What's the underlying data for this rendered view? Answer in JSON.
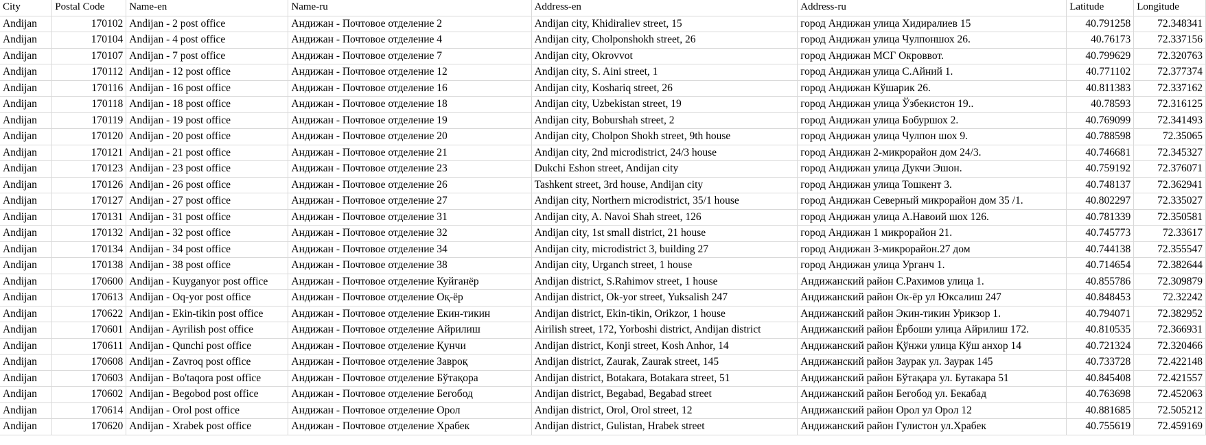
{
  "table": {
    "columns": [
      {
        "key": "city",
        "label": "City"
      },
      {
        "key": "postal",
        "label": "Postal Code"
      },
      {
        "key": "name_en",
        "label": "Name-en"
      },
      {
        "key": "name_ru",
        "label": "Name-ru"
      },
      {
        "key": "address_en",
        "label": "Address-en"
      },
      {
        "key": "address_ru",
        "label": "Address-ru"
      },
      {
        "key": "latitude",
        "label": "Latitude"
      },
      {
        "key": "longitude",
        "label": "Longitude"
      }
    ],
    "rows": [
      {
        "city": "Andijan",
        "postal": "170102",
        "name_en": "Andijan - 2 post office",
        "name_ru": "Андижан - Почтовое отделение 2",
        "address_en": "Andijan city, Khidiraliev street, 15",
        "address_ru": "город Андижан улица  Хидиралиев  15",
        "latitude": "40.791258",
        "longitude": "72.348341"
      },
      {
        "city": "Andijan",
        "postal": "170104",
        "name_en": "Andijan - 4 post office",
        "name_ru": "Андижан - Почтовое отделение 4",
        "address_en": "Andijan city, Cholponshokh street, 26",
        "address_ru": "город Андижан улица   Чулпоншох 26.",
        "latitude": "40.76173",
        "longitude": "72.337156"
      },
      {
        "city": "Andijan",
        "postal": "170107",
        "name_en": "Andijan - 7 post office",
        "name_ru": "Андижан - Почтовое отделение 7",
        "address_en": "Andijan city, Okrovvot",
        "address_ru": "город Андижан    МСГ Окроввот.",
        "latitude": "40.799629",
        "longitude": "72.320763"
      },
      {
        "city": "Andijan",
        "postal": "170112",
        "name_en": "Andijan - 12 post office",
        "name_ru": "Андижан - Почтовое отделение 12",
        "address_en": "Andijan city, S. Aini street, 1",
        "address_ru": "город Андижан улица   С.Айний 1.",
        "latitude": "40.771102",
        "longitude": "72.377374"
      },
      {
        "city": "Andijan",
        "postal": "170116",
        "name_en": "Andijan - 16 post office",
        "name_ru": "Андижан - Почтовое отделение 16",
        "address_en": "Andijan city, Koshariq street, 26",
        "address_ru": "город Андижан    Кўшарик  26.",
        "latitude": "40.811383",
        "longitude": "72.337162"
      },
      {
        "city": "Andijan",
        "postal": "170118",
        "name_en": "Andijan - 18 post office",
        "name_ru": "Андижан - Почтовое отделение 18",
        "address_en": "Andijan city, Uzbekistan street, 19",
        "address_ru": "город Андижан улица   Ўзбекистон 19..",
        "latitude": "40.78593",
        "longitude": "72.316125"
      },
      {
        "city": "Andijan",
        "postal": "170119",
        "name_en": "Andijan - 19 post office",
        "name_ru": "Андижан - Почтовое отделение 19",
        "address_en": "Andijan city, Boburshah street, 2",
        "address_ru": "город Андижан улица   Бобуршох 2.",
        "latitude": "40.769099",
        "longitude": "72.341493"
      },
      {
        "city": "Andijan",
        "postal": "170120",
        "name_en": "Andijan - 20 post office",
        "name_ru": "Андижан - Почтовое отделение 20",
        "address_en": "Andijan city, Cholpon Shokh street, 9th house",
        "address_ru": "город Андижан улица  Чулпон шох 9.",
        "latitude": "40.788598",
        "longitude": "72.35065"
      },
      {
        "city": "Andijan",
        "postal": "170121",
        "name_en": "Andijan - 21 post office",
        "name_ru": "Андижан - Почтовое отделение 21",
        "address_en": "Andijan city, 2nd microdistrict, 24/3 house",
        "address_ru": "город Андижан 2-микрорайон  дом  24/3.",
        "latitude": "40.746681",
        "longitude": "72.345327"
      },
      {
        "city": "Andijan",
        "postal": "170123",
        "name_en": "Andijan - 23 post office",
        "name_ru": "Андижан - Почтовое отделение 23",
        "address_en": "Dukchi Eshon street, Andijan city",
        "address_ru": "город Андижан улица   Дукчи Эшон.",
        "latitude": "40.759192",
        "longitude": "72.376071"
      },
      {
        "city": "Andijan",
        "postal": "170126",
        "name_en": "Andijan - 26 post office",
        "name_ru": "Андижан - Почтовое отделение 26",
        "address_en": "Tashkent street, 3rd house, Andijan city",
        "address_ru": "город Андижан улица    Тошкент  3.",
        "latitude": "40.748137",
        "longitude": "72.362941"
      },
      {
        "city": "Andijan",
        "postal": "170127",
        "name_en": "Andijan - 27 post office",
        "name_ru": "Андижан - Почтовое отделение 27",
        "address_en": "Andijan city, Northern microdistrict, 35/1 house",
        "address_ru": "город Андижан   Северный микрорайон дом 35 /1.",
        "latitude": "40.802297",
        "longitude": "72.335027"
      },
      {
        "city": "Andijan",
        "postal": "170131",
        "name_en": "Andijan - 31 post office",
        "name_ru": "Андижан - Почтовое отделение 31",
        "address_en": "Andijan city, A. Navoi Shah street, 126",
        "address_ru": "город Андижан улица   А.Навоий шох 126.",
        "latitude": "40.781339",
        "longitude": "72.350581"
      },
      {
        "city": "Andijan",
        "postal": "170132",
        "name_en": "Andijan - 32 post office",
        "name_ru": "Андижан - Почтовое отделение 32",
        "address_en": "Andijan city, 1st small district, 21 house",
        "address_ru": "город Андижан 1 микрорайон 21.",
        "latitude": "40.745773",
        "longitude": "72.33617"
      },
      {
        "city": "Andijan",
        "postal": "170134",
        "name_en": "Andijan - 34 post office",
        "name_ru": "Андижан - Почтовое отделение 34",
        "address_en": "Andijan city, microdistrict 3, building 27",
        "address_ru": "город Андижан 3-микрорайон.27 дом",
        "latitude": "40.744138",
        "longitude": "72.355547"
      },
      {
        "city": "Andijan",
        "postal": "170138",
        "name_en": "Andijan - 38 post office",
        "name_ru": "Андижан - Почтовое отделение 38",
        "address_en": "Andijan city, Urganch street, 1 house",
        "address_ru": "город Андижан улица   Урганч 1.",
        "latitude": "40.714654",
        "longitude": "72.382644"
      },
      {
        "city": "Andijan",
        "postal": "170600",
        "name_en": "Andijan - Kuyganyor post office",
        "name_ru": "Андижан - Почтовое отделение Куйганёр",
        "address_en": "Andijan district, S.Rahimov street, 1 house",
        "address_ru": "Андижанский район С.Рахимов улица  1.",
        "latitude": "40.855786",
        "longitude": "72.309879"
      },
      {
        "city": "Andijan",
        "postal": "170613",
        "name_en": "Andijan - Oq-yor post office",
        "name_ru": "Андижан - Почтовое отделение Оқ-ёр",
        "address_en": "Andijan district, Ok-yor street, Yuksalish 247",
        "address_ru": "Андижанский район  Ок-ёр  ул Юксалиш   247",
        "latitude": "40.848453",
        "longitude": "72.32242"
      },
      {
        "city": "Andijan",
        "postal": "170622",
        "name_en": "Andijan - Ekin-tikin post office",
        "name_ru": "Андижан - Почтовое отделение Екин-тикин",
        "address_en": "Andijan district, Ekin-tikin, Orikzor, 1 house",
        "address_ru": "Андижанский район Экин-тикин  Урикзор 1.",
        "latitude": "40.794071",
        "longitude": "72.382952"
      },
      {
        "city": "Andijan",
        "postal": "170601",
        "name_en": "Andijan - Ayrilish post office",
        "name_ru": "Андижан - Почтовое отделение Айрилиш",
        "address_en": "Airilish street, 172, Yorboshi district, Andijan district",
        "address_ru": "Андижанский район Ёрбоши  улица Айрилиш 172.",
        "latitude": "40.810535",
        "longitude": "72.366931"
      },
      {
        "city": "Andijan",
        "postal": "170611",
        "name_en": "Andijan - Qunchi post office",
        "name_ru": "Андижан - Почтовое отделение Қунчи",
        "address_en": "Andijan district, Konji street, Kosh Anhor, 14",
        "address_ru": "Андижанский район  Қўнжи  улица Кўш анхор 14",
        "latitude": "40.721324",
        "longitude": "72.320466"
      },
      {
        "city": "Andijan",
        "postal": "170608",
        "name_en": "Andijan - Zavroq post office",
        "name_ru": "Андижан - Почтовое отделение Завроқ",
        "address_en": "Andijan district, Zaurak, Zaurak street, 145",
        "address_ru": "Андижанский район  Заурак  ул. Заурак  145",
        "latitude": "40.733728",
        "longitude": "72.422148"
      },
      {
        "city": "Andijan",
        "postal": "170603",
        "name_en": "Andijan - Bo'taqora post office",
        "name_ru": "Андижан - Почтовое отделение Бўтақора",
        "address_en": "Andijan district, Botakara, Botakara street, 51",
        "address_ru": "Андижанский район  Бўтақара  ул. Бутакара  51",
        "latitude": "40.845408",
        "longitude": "72.421557"
      },
      {
        "city": "Andijan",
        "postal": "170602",
        "name_en": "Andijan - Begobod post office",
        "name_ru": "Андижан - Почтовое отделение Бегобод",
        "address_en": "Andijan district, Begabad, Begabad street",
        "address_ru": "Андижанский район  Бегобод  ул. Бекабад",
        "latitude": "40.763698",
        "longitude": "72.452063"
      },
      {
        "city": "Andijan",
        "postal": "170614",
        "name_en": "Andijan - Orol post office",
        "name_ru": "Андижан - Почтовое отделение Орол",
        "address_en": "Andijan district, Orol, Orol street, 12",
        "address_ru": "Андижанский район  Орол ул Орол 12",
        "latitude": "40.881685",
        "longitude": "72.505212"
      },
      {
        "city": "Andijan",
        "postal": "170620",
        "name_en": "Andijan - Xrabek post office",
        "name_ru": "Андижан - Почтовое отделение Храбек",
        "address_en": "Andijan district, Gulistan, Hrabek street",
        "address_ru": "Андижанский район  Гулистон ул.Храбек",
        "latitude": "40.755619",
        "longitude": "72.459169"
      }
    ]
  }
}
